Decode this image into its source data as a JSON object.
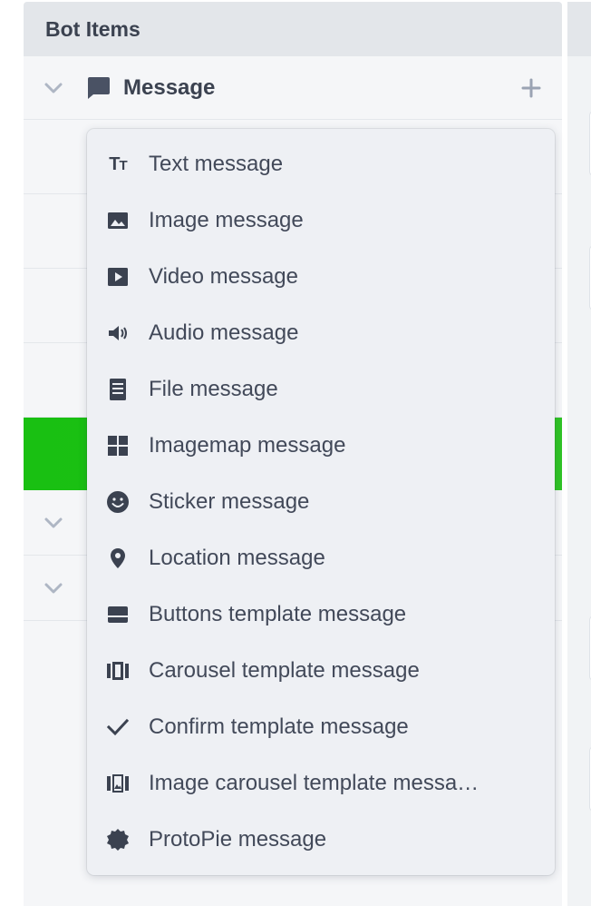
{
  "panel": {
    "title": "Bot Items"
  },
  "section": {
    "label": "Message",
    "icon": "chat-bubble-icon",
    "add_icon": "plus-icon",
    "expand_icon": "chevron-down-icon"
  },
  "colors": {
    "active_row": "#1cbf13",
    "text": "#424959",
    "icon": "#3b4250",
    "dropdown_bg": "#eef0f4"
  },
  "menu": {
    "items": [
      {
        "label": "Text message",
        "icon": "text-format-icon"
      },
      {
        "label": "Image message",
        "icon": "image-icon"
      },
      {
        "label": "Video message",
        "icon": "video-play-icon"
      },
      {
        "label": "Audio message",
        "icon": "speaker-icon"
      },
      {
        "label": "File message",
        "icon": "file-icon"
      },
      {
        "label": "Imagemap message",
        "icon": "grid-icon"
      },
      {
        "label": "Sticker message",
        "icon": "smiley-icon"
      },
      {
        "label": "Location message",
        "icon": "location-pin-icon"
      },
      {
        "label": "Buttons template message",
        "icon": "buttons-template-icon"
      },
      {
        "label": "Carousel template message",
        "icon": "carousel-icon"
      },
      {
        "label": "Confirm template message",
        "icon": "checkmark-icon"
      },
      {
        "label": "Image carousel template messa…",
        "icon": "image-carousel-icon"
      },
      {
        "label": "ProtoPie message",
        "icon": "protopie-badge-icon"
      }
    ]
  }
}
